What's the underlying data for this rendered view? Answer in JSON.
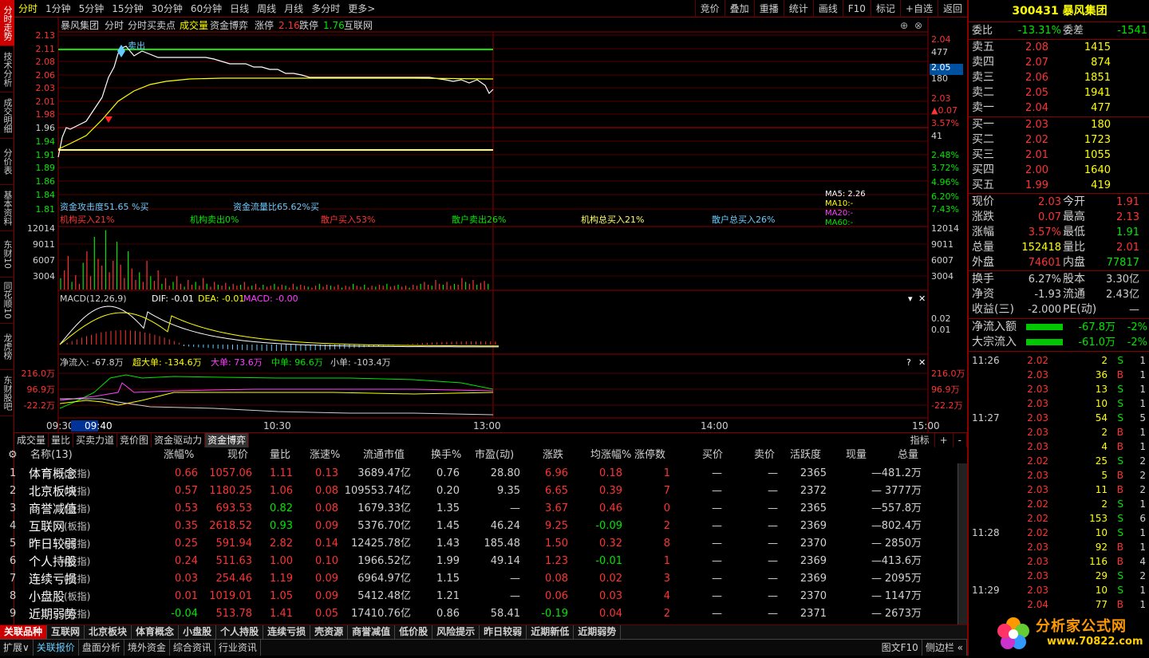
{
  "vtabs": [
    "分时走势",
    "技术分析",
    "成交明细",
    "分价表",
    "基本资料",
    "东财10",
    "同花顺10",
    "龙虎榜",
    "东财股吧"
  ],
  "toolbar": {
    "periods": [
      "分时",
      "1分钟",
      "5分钟",
      "15分钟",
      "30分钟",
      "60分钟",
      "日线",
      "周线",
      "月线",
      "多分时",
      "更多>"
    ],
    "right": [
      "竞价",
      "叠加",
      "重播",
      "统计",
      "画线",
      "F10",
      "标记",
      "+自选",
      "返回"
    ]
  },
  "chart_header": {
    "name": "暴风集团",
    "items": [
      "分时",
      "分时买卖点",
      "成交量",
      "资金博弈"
    ],
    "zt_label": "涨停",
    "zt": "2.16",
    "dt_label": "跌停",
    "dt": "1.76",
    "site": "互联网"
  },
  "price_axis": {
    "left": [
      "2.13",
      "2.11",
      "2.08",
      "2.06",
      "2.03",
      "2.01",
      "1.98",
      "1.96",
      "1.94",
      "1.91",
      "1.89",
      "1.86",
      "1.84",
      "1.81"
    ],
    "right": [
      "2.04",
      "477",
      "2.05",
      "180",
      "2.03",
      "▲0.07",
      "3.57%",
      "41",
      "2.48%",
      "3.72%",
      "4.96%",
      "6.20%",
      "7.43%"
    ]
  },
  "sell_mark": "卖出",
  "flow_text": {
    "attack": "资金攻击度51.65 %买",
    "ratio": "资金流量比65.62%买"
  },
  "inst_text": [
    "机构买入21%",
    "机构卖出0%",
    "散户买入53%",
    "散户卖出26%",
    "机构总买入21%",
    "散户总买入26%"
  ],
  "ma_text": [
    "MA5:  2.26",
    "MA10:-",
    "MA20:-",
    "MA60:-"
  ],
  "vol_axis": [
    "12014",
    "9011",
    "6007",
    "3004"
  ],
  "macd_header": {
    "name": "MACD(12,26,9)",
    "dif": "DIF: -0.01",
    "dea": "DEA: -0.01",
    "macd": "MACD: -0.00"
  },
  "macd_axis": [
    "0.02",
    "0.01"
  ],
  "netflow_header": {
    "net": "净流入: -67.8万",
    "super": "超大单: -134.6万",
    "big": "大单: 73.6万",
    "mid": "中单: 96.6万",
    "small": "小单: -103.4万"
  },
  "netflow_axis": [
    "216.0万",
    "96.9万",
    "-22.2万"
  ],
  "time_axis": [
    "09:30",
    "09:40",
    "10:30",
    "13:00",
    "14:00",
    "15:00"
  ],
  "bottom_tabs": [
    "成交量",
    "量比",
    "买卖力道",
    "竞价图",
    "资金驱动力",
    "资金博弈"
  ],
  "bottom_tabs_right": [
    "指标",
    "+",
    "-"
  ],
  "table": {
    "headers": [
      "名称(13)",
      "涨幅%",
      "现价",
      "量比",
      "涨速%",
      "流通市值",
      "换手%",
      "市盈(动)",
      "涨跌",
      "均涨幅%",
      "涨停数",
      "买价",
      "卖价",
      "活跃度",
      "现量",
      "总量"
    ],
    "rows": [
      [
        "1",
        "体育概念",
        "(板指)",
        "0.66",
        "1057.06",
        "1.11",
        "0.13",
        "3689.47亿",
        "0.76",
        "28.80",
        "6.96",
        "0.18",
        "1",
        "—",
        "—",
        "2365",
        "—",
        "481.2万"
      ],
      [
        "2",
        "北京板块",
        "(板指)",
        "0.57",
        "1180.25",
        "1.06",
        "0.08",
        "109553.74亿",
        "0.20",
        "9.35",
        "6.65",
        "0.39",
        "7",
        "—",
        "—",
        "2372",
        "—",
        "3777万"
      ],
      [
        "3",
        "商誉减值",
        "(板指)",
        "0.53",
        "693.53",
        "0.82",
        "0.08",
        "1679.33亿",
        "1.35",
        "—",
        "3.67",
        "0.46",
        "0",
        "—",
        "—",
        "2365",
        "—",
        "557.8万"
      ],
      [
        "4",
        "互联网",
        "(板指)",
        "0.35",
        "2618.52",
        "0.93",
        "0.09",
        "5376.70亿",
        "1.45",
        "46.24",
        "9.25",
        "-0.09",
        "2",
        "—",
        "—",
        "2369",
        "—",
        "802.4万"
      ],
      [
        "5",
        "昨日较弱",
        "(板指)",
        "0.25",
        "591.94",
        "2.82",
        "0.14",
        "12425.78亿",
        "1.43",
        "185.48",
        "1.50",
        "0.32",
        "8",
        "—",
        "—",
        "2370",
        "—",
        "2850万"
      ],
      [
        "6",
        "个人持股",
        "(板指)",
        "0.24",
        "511.63",
        "1.00",
        "0.10",
        "1966.52亿",
        "1.99",
        "49.14",
        "1.23",
        "-0.01",
        "1",
        "—",
        "—",
        "2369",
        "—",
        "413.6万"
      ],
      [
        "7",
        "连续亏损",
        "(板指)",
        "0.03",
        "254.46",
        "1.19",
        "0.09",
        "6964.97亿",
        "1.15",
        "—",
        "0.08",
        "0.02",
        "3",
        "—",
        "—",
        "2369",
        "—",
        "2095万"
      ],
      [
        "8",
        "小盘股",
        "(板指)",
        "0.01",
        "1019.01",
        "1.05",
        "0.09",
        "5412.48亿",
        "1.21",
        "—",
        "0.06",
        "0.03",
        "4",
        "—",
        "—",
        "2370",
        "—",
        "1147万"
      ],
      [
        "9",
        "近期弱势",
        "(板指)",
        "-0.04",
        "513.78",
        "1.41",
        "0.05",
        "17410.76亿",
        "0.86",
        "58.41",
        "-0.19",
        "0.04",
        "2",
        "—",
        "—",
        "2371",
        "—",
        "2673万"
      ]
    ]
  },
  "sectors": [
    "关联品种",
    "互联网",
    "北京板块",
    "体育概念",
    "小盘股",
    "个人持股",
    "连续亏损",
    "壳资源",
    "商誉减值",
    "低价股",
    "风险提示",
    "昨日较弱",
    "近期新低",
    "近期弱势"
  ],
  "statusbar": [
    "扩展∨",
    "关联报价",
    "盘面分析",
    "境外资金",
    "综合资讯",
    "行业资讯"
  ],
  "statusbar_right": [
    "图文F10",
    "侧边栏 «"
  ],
  "rpanel": {
    "code": "300431",
    "name": "暴风集团",
    "webi_label": "委比",
    "webi": "-13.31%",
    "weicha_label": "委差",
    "weicha": "-1541",
    "sells": [
      [
        "卖五",
        "2.08",
        "1415"
      ],
      [
        "卖四",
        "2.07",
        "874"
      ],
      [
        "卖三",
        "2.06",
        "1851"
      ],
      [
        "卖二",
        "2.05",
        "1941"
      ],
      [
        "卖一",
        "2.04",
        "477"
      ]
    ],
    "buys": [
      [
        "买一",
        "2.03",
        "180"
      ],
      [
        "买二",
        "2.02",
        "1723"
      ],
      [
        "买三",
        "2.01",
        "1055"
      ],
      [
        "买四",
        "2.00",
        "1640"
      ],
      [
        "买五",
        "1.99",
        "419"
      ]
    ],
    "quote": [
      [
        "现价",
        "2.03",
        "今开",
        "1.91"
      ],
      [
        "涨跌",
        "0.07",
        "最高",
        "2.13"
      ],
      [
        "涨幅",
        "3.57%",
        "最低",
        "1.91"
      ],
      [
        "总量",
        "152418",
        "量比",
        "2.01"
      ],
      [
        "外盘",
        "74601",
        "内盘",
        "77817"
      ]
    ],
    "info": [
      [
        "换手",
        "6.27%",
        "股本",
        "3.30亿"
      ],
      [
        "净资",
        "-1.93",
        "流通",
        "2.43亿"
      ],
      [
        "收益(三)",
        "-2.000",
        "PE(动)",
        "—"
      ]
    ],
    "flows": [
      [
        "净流入额",
        "-67.8万",
        "-2%"
      ],
      [
        "大宗流入",
        "-61.0万",
        "-2%"
      ]
    ],
    "ticks": [
      [
        "11:26",
        "2.02",
        "2",
        "S",
        "1"
      ],
      [
        "",
        "2.03",
        "36",
        "B",
        "1"
      ],
      [
        "",
        "2.03",
        "13",
        "S",
        "1"
      ],
      [
        "",
        "2.03",
        "10",
        "S",
        "1"
      ],
      [
        "11:27",
        "2.03",
        "54",
        "S",
        "5"
      ],
      [
        "",
        "2.03",
        "2",
        "B",
        "1"
      ],
      [
        "",
        "2.03",
        "4",
        "B",
        "1"
      ],
      [
        "",
        "2.02",
        "25",
        "S",
        "2"
      ],
      [
        "",
        "2.03",
        "5",
        "B",
        "2"
      ],
      [
        "",
        "2.03",
        "11",
        "B",
        "2"
      ],
      [
        "",
        "2.02",
        "2",
        "S",
        "1"
      ],
      [
        "",
        "2.02",
        "153",
        "S",
        "6"
      ],
      [
        "11:28",
        "2.02",
        "10",
        "S",
        "1"
      ],
      [
        "",
        "2.03",
        "92",
        "B",
        "1"
      ],
      [
        "",
        "2.03",
        "116",
        "B",
        "4"
      ],
      [
        "",
        "2.03",
        "29",
        "S",
        "2"
      ],
      [
        "11:29",
        "2.03",
        "10",
        "S",
        "1"
      ],
      [
        "",
        "2.04",
        "77",
        "B",
        "1"
      ]
    ]
  },
  "logo": {
    "text": "分析家公式网",
    "url": "www.70822.com"
  },
  "colors": {
    "up": "#ff3333",
    "down": "#00e600",
    "frame": "#880000"
  }
}
